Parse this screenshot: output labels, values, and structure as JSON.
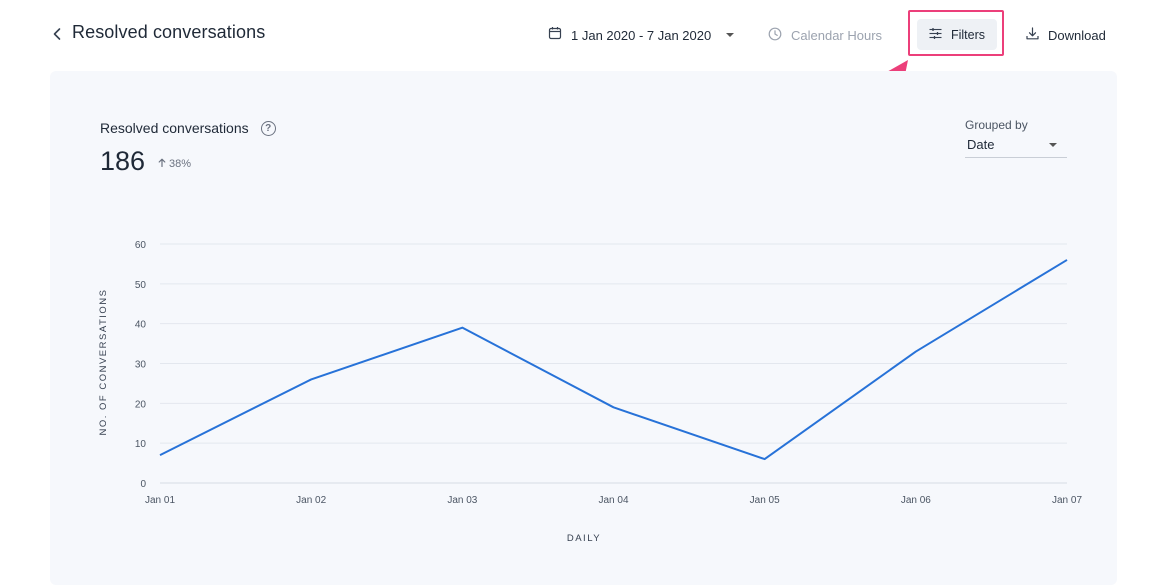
{
  "header": {
    "title": "Resolved conversations",
    "date_range": "1 Jan 2020 - 7 Jan 2020",
    "calendar_hours": "Calendar Hours",
    "filters": "Filters",
    "download": "Download"
  },
  "metric": {
    "title": "Resolved conversations",
    "value": "186",
    "change": "38%"
  },
  "grouped_by": {
    "label": "Grouped by",
    "value": "Date"
  },
  "colors": {
    "line": "#2772d8",
    "highlight": "#ec3f7a",
    "card": "#f6f8fc"
  },
  "chart_data": {
    "type": "line",
    "categories": [
      "Jan 01",
      "Jan 02",
      "Jan 03",
      "Jan 04",
      "Jan 05",
      "Jan 06",
      "Jan 07"
    ],
    "values": [
      7,
      26,
      39,
      19,
      6,
      33,
      56
    ],
    "ylim": [
      0,
      60
    ],
    "yticks": [
      "0",
      "10",
      "20",
      "30",
      "40",
      "50",
      "60"
    ],
    "xlabel": "DAILY",
    "ylabel": "NO. OF CONVERSATIONS",
    "grid": true
  }
}
